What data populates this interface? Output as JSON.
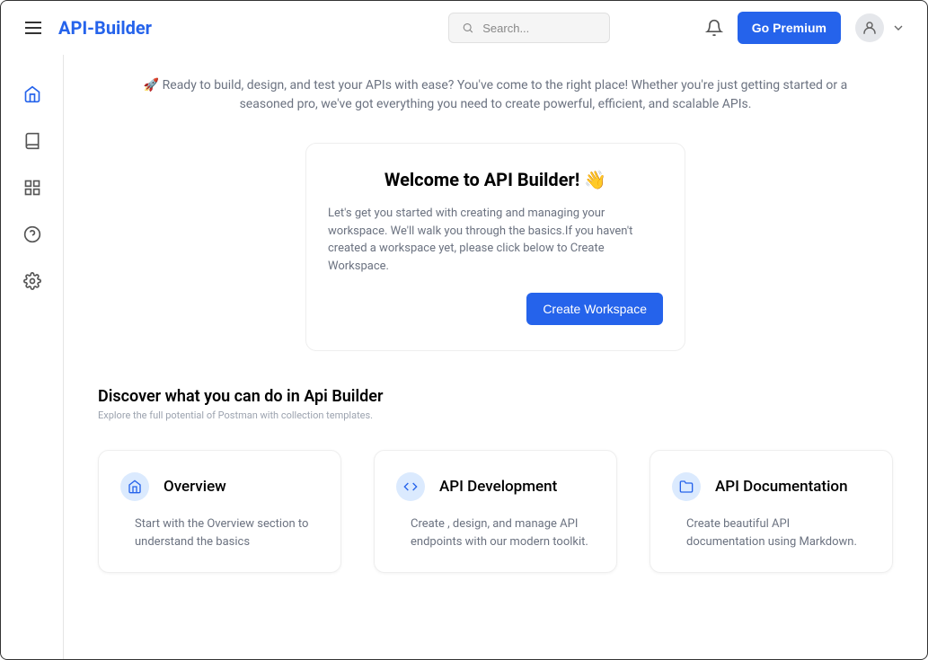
{
  "header": {
    "logo": "API-Builder",
    "searchPlaceholder": "Search...",
    "premiumLabel": "Go Premium"
  },
  "intro": "🚀 Ready to build, design, and test your APIs with ease? You've come to the right place! Whether you're just getting started or a seasoned pro, we've got everything you need to create powerful, efficient, and scalable APIs.",
  "welcome": {
    "title": "Welcome to API Builder! 👋",
    "body": "Let's get you started with creating and managing your workspace. We'll walk you through the basics.If you haven't created a workspace yet, please click below to Create Workspace.",
    "button": "Create Workspace"
  },
  "discover": {
    "heading": "Discover what you can do in Api Builder",
    "sub": "Explore the full potential of Postman with collection templates.",
    "cards": [
      {
        "title": "Overview",
        "desc": "Start with the Overview section to understand the basics"
      },
      {
        "title": "API Development",
        "desc": "Create , design, and manage API endpoints with our modern toolkit."
      },
      {
        "title": "API Documentation",
        "desc": "Create beautiful API documentation using Markdown."
      }
    ]
  }
}
